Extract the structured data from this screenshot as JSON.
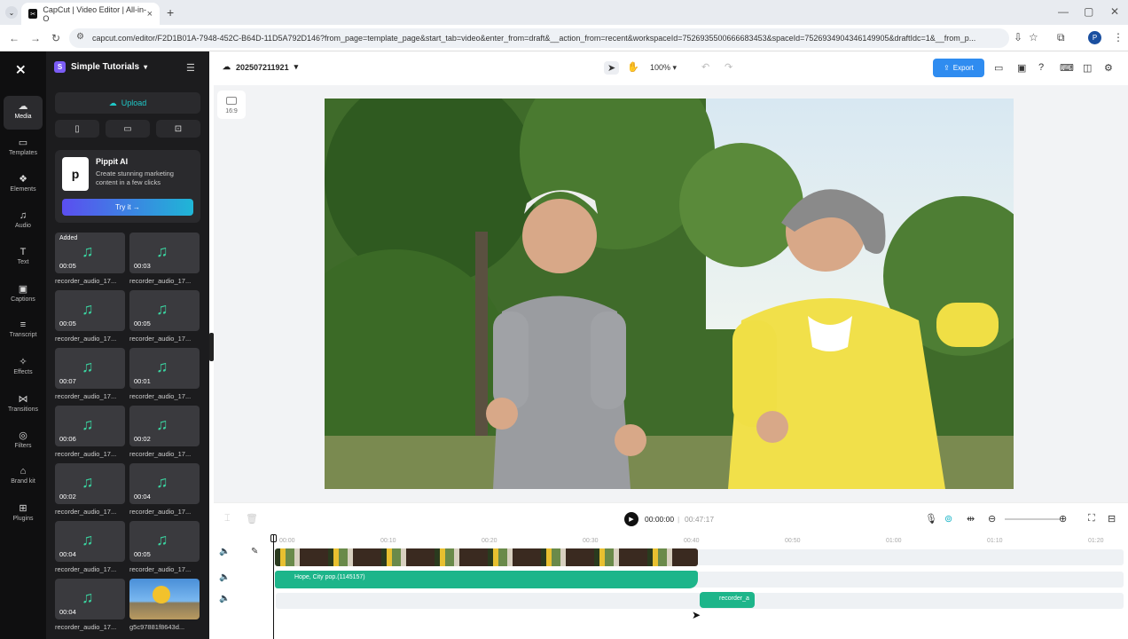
{
  "browser": {
    "tab_title": "CapCut | Video Editor | All-in-O",
    "tab_close": "×",
    "new_tab": "+",
    "url": "capcut.com/editor/F2D1B01A-7948-452C-B64D-11D5A792D146?from_page=template_page&start_tab=video&enter_from=draft&__action_from=recent&workspaceId=7526935500666683453&spaceId=7526934904346149905&draftIdc=1&__from_p...",
    "profile_initial": "P"
  },
  "rail": {
    "items": [
      {
        "label": "Media",
        "icon": "☁"
      },
      {
        "label": "Templates",
        "icon": "▭"
      },
      {
        "label": "Elements",
        "icon": "❖"
      },
      {
        "label": "Audio",
        "icon": "♫"
      },
      {
        "label": "Text",
        "icon": "T"
      },
      {
        "label": "Captions",
        "icon": "▣"
      },
      {
        "label": "Transcript",
        "icon": "≡"
      },
      {
        "label": "Effects",
        "icon": "✧"
      },
      {
        "label": "Transitions",
        "icon": "⋈"
      },
      {
        "label": "Filters",
        "icon": "◎"
      },
      {
        "label": "Brand kit",
        "icon": "⌂"
      },
      {
        "label": "Plugins",
        "icon": "⊞"
      }
    ]
  },
  "panel": {
    "workspace_name": "Simple Tutorials",
    "workspace_initial": "S",
    "upload_label": "Upload",
    "promo": {
      "title": "Pippit AI",
      "desc": "Create stunning marketing content in a few clicks",
      "cta": "Try it →"
    },
    "media": [
      {
        "duration": "00:05",
        "label": "recorder_audio_17...",
        "added": "Added"
      },
      {
        "duration": "00:03",
        "label": "recorder_audio_17..."
      },
      {
        "duration": "00:05",
        "label": "recorder_audio_17..."
      },
      {
        "duration": "00:05",
        "label": "recorder_audio_17..."
      },
      {
        "duration": "00:07",
        "label": "recorder_audio_17..."
      },
      {
        "duration": "00:01",
        "label": "recorder_audio_17..."
      },
      {
        "duration": "00:06",
        "label": "recorder_audio_17..."
      },
      {
        "duration": "00:02",
        "label": "recorder_audio_17..."
      },
      {
        "duration": "00:02",
        "label": "recorder_audio_17..."
      },
      {
        "duration": "00:04",
        "label": "recorder_audio_17..."
      },
      {
        "duration": "00:04",
        "label": "recorder_audio_17..."
      },
      {
        "duration": "00:05",
        "label": "recorder_audio_17..."
      },
      {
        "duration": "00:04",
        "label": "recorder_audio_17..."
      },
      {
        "duration": "",
        "label": "g5c97881f8643d...",
        "image": true
      }
    ]
  },
  "editor": {
    "project_name": "202507211921",
    "zoom": "100%",
    "export_label": "Export",
    "aspect_ratio": "16:9",
    "time_current": "00:00:00",
    "time_total": "00:47:17"
  },
  "timeline": {
    "ruler": [
      "00:00",
      "00:10",
      "00:20",
      "00:30",
      "00:40",
      "00:50",
      "01:00",
      "01:10",
      "01:20"
    ],
    "audio_clip_label": "Hope, City pop.(1145157)",
    "recorder_clip_label": "recorder_a"
  }
}
